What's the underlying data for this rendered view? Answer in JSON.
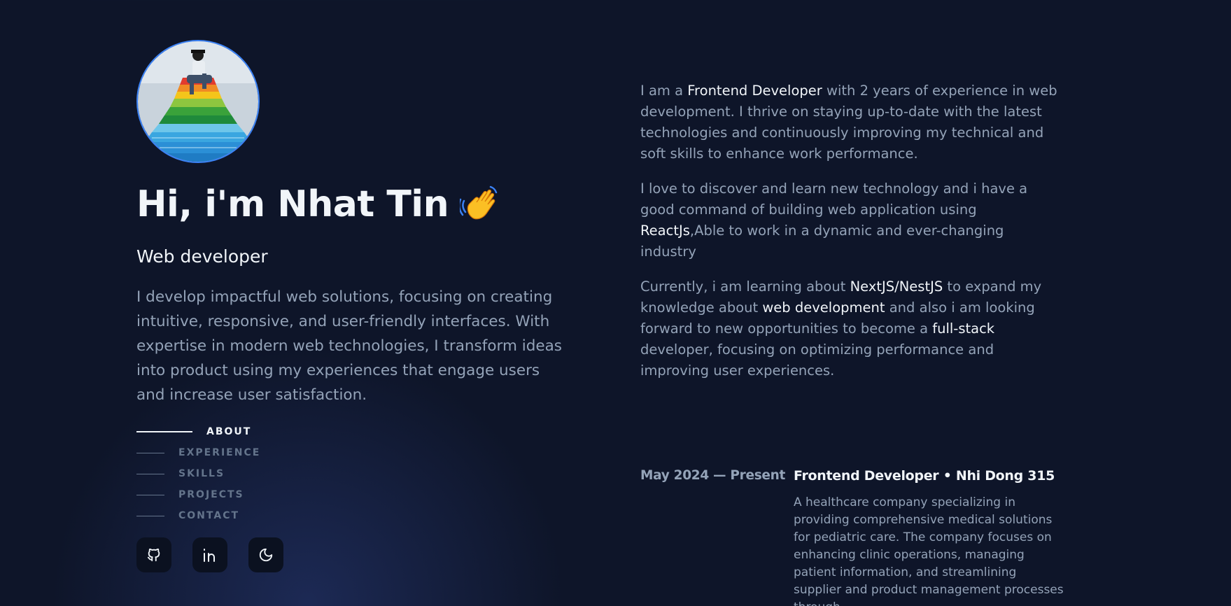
{
  "profile": {
    "greeting": "Hi, i'm Nhat Tin",
    "wave_emoji": "wave-hand-icon",
    "role": "Web developer",
    "intro": "I develop impactful web solutions, focusing on creating intuitive, responsive, and user-friendly interfaces. With expertise in modern web technologies, I transform ideas into product using my experiences that engage users and increase user satisfaction."
  },
  "nav": {
    "items": [
      {
        "label": "ABOUT",
        "active": true
      },
      {
        "label": "EXPERIENCE",
        "active": false
      },
      {
        "label": "SKILLS",
        "active": false
      },
      {
        "label": "PROJECTS",
        "active": false
      },
      {
        "label": "CONTACT",
        "active": false
      }
    ]
  },
  "socials": [
    {
      "icon": "github-icon"
    },
    {
      "icon": "linkedin-icon"
    },
    {
      "icon": "moon-icon"
    }
  ],
  "about": {
    "p1": {
      "a": "I am a ",
      "b": "Frontend Developer",
      "c": " with 2 years of experience in web development. I thrive on staying up-to-date with the latest technologies and continuously improving my technical and soft skills to enhance work performance."
    },
    "p2": {
      "a": "I love to discover and learn new technology and i have a good command of building web application using ",
      "b": "ReactJs",
      "c": ",Able to work in a dynamic and ever-changing industry"
    },
    "p3": {
      "a": "Currently, i am learning about ",
      "b": "NextJS/NestJS",
      "c": " to expand my knowledge about ",
      "d": "web development",
      "e": " and also i am looking forward to new opportunities to become a ",
      "f": "full-stack",
      "g": " developer, focusing on optimizing performance and improving user experiences."
    }
  },
  "experience": [
    {
      "date": "May 2024 — Present",
      "title": "Frontend Developer • Nhi Dong 315",
      "description": "A healthcare company specializing in providing comprehensive medical solutions for pediatric care. The company focuses on enhancing clinic operations, managing patient information, and streamlining supplier and product management processes through"
    }
  ],
  "colors": {
    "background": "#0f172a",
    "text_primary": "#f1f5f9",
    "text_secondary": "#94a3b8",
    "accent": "#3b82f6"
  }
}
